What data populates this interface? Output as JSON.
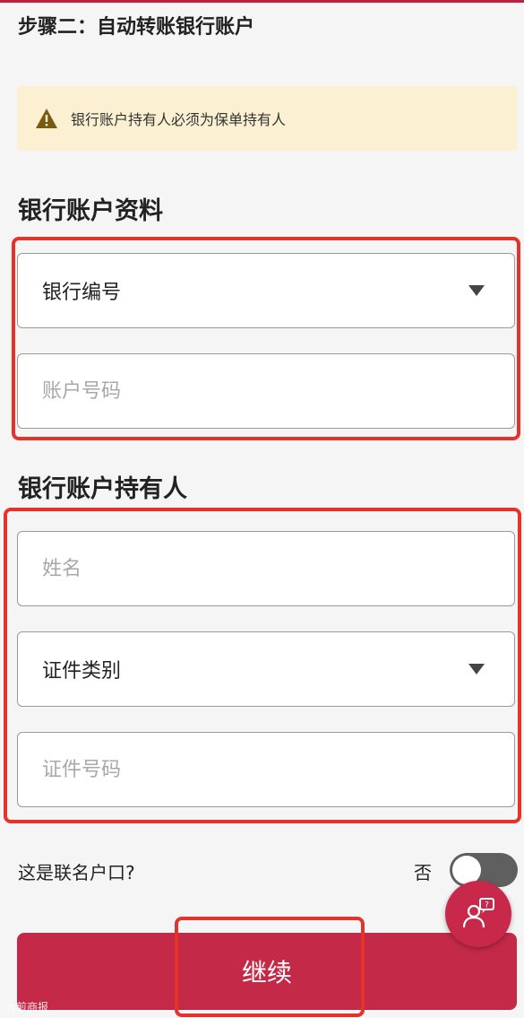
{
  "step_title": "步骤二：自动转账银行账户",
  "warning": {
    "icon": "warning-triangle-icon",
    "text": "银行账户持有人必须为保单持有人"
  },
  "bank_account_section": {
    "title": "银行账户资料",
    "bank_code_select": "银行编号",
    "account_number_placeholder": "账户号码"
  },
  "holder_section": {
    "title": "银行账户持有人",
    "name_placeholder": "姓名",
    "id_type_select": "证件类别",
    "id_number_placeholder": "证件号码"
  },
  "joint_account": {
    "question": "这是联名户口?",
    "toggle_state": "否",
    "toggle_on": false
  },
  "continue_label": "继续",
  "watermark": "大煎商报",
  "colors": {
    "brand": "#c42a48",
    "highlight": "#e6332a",
    "warning_bg": "#fbf0d2",
    "warning_icon": "#7a5c10"
  }
}
